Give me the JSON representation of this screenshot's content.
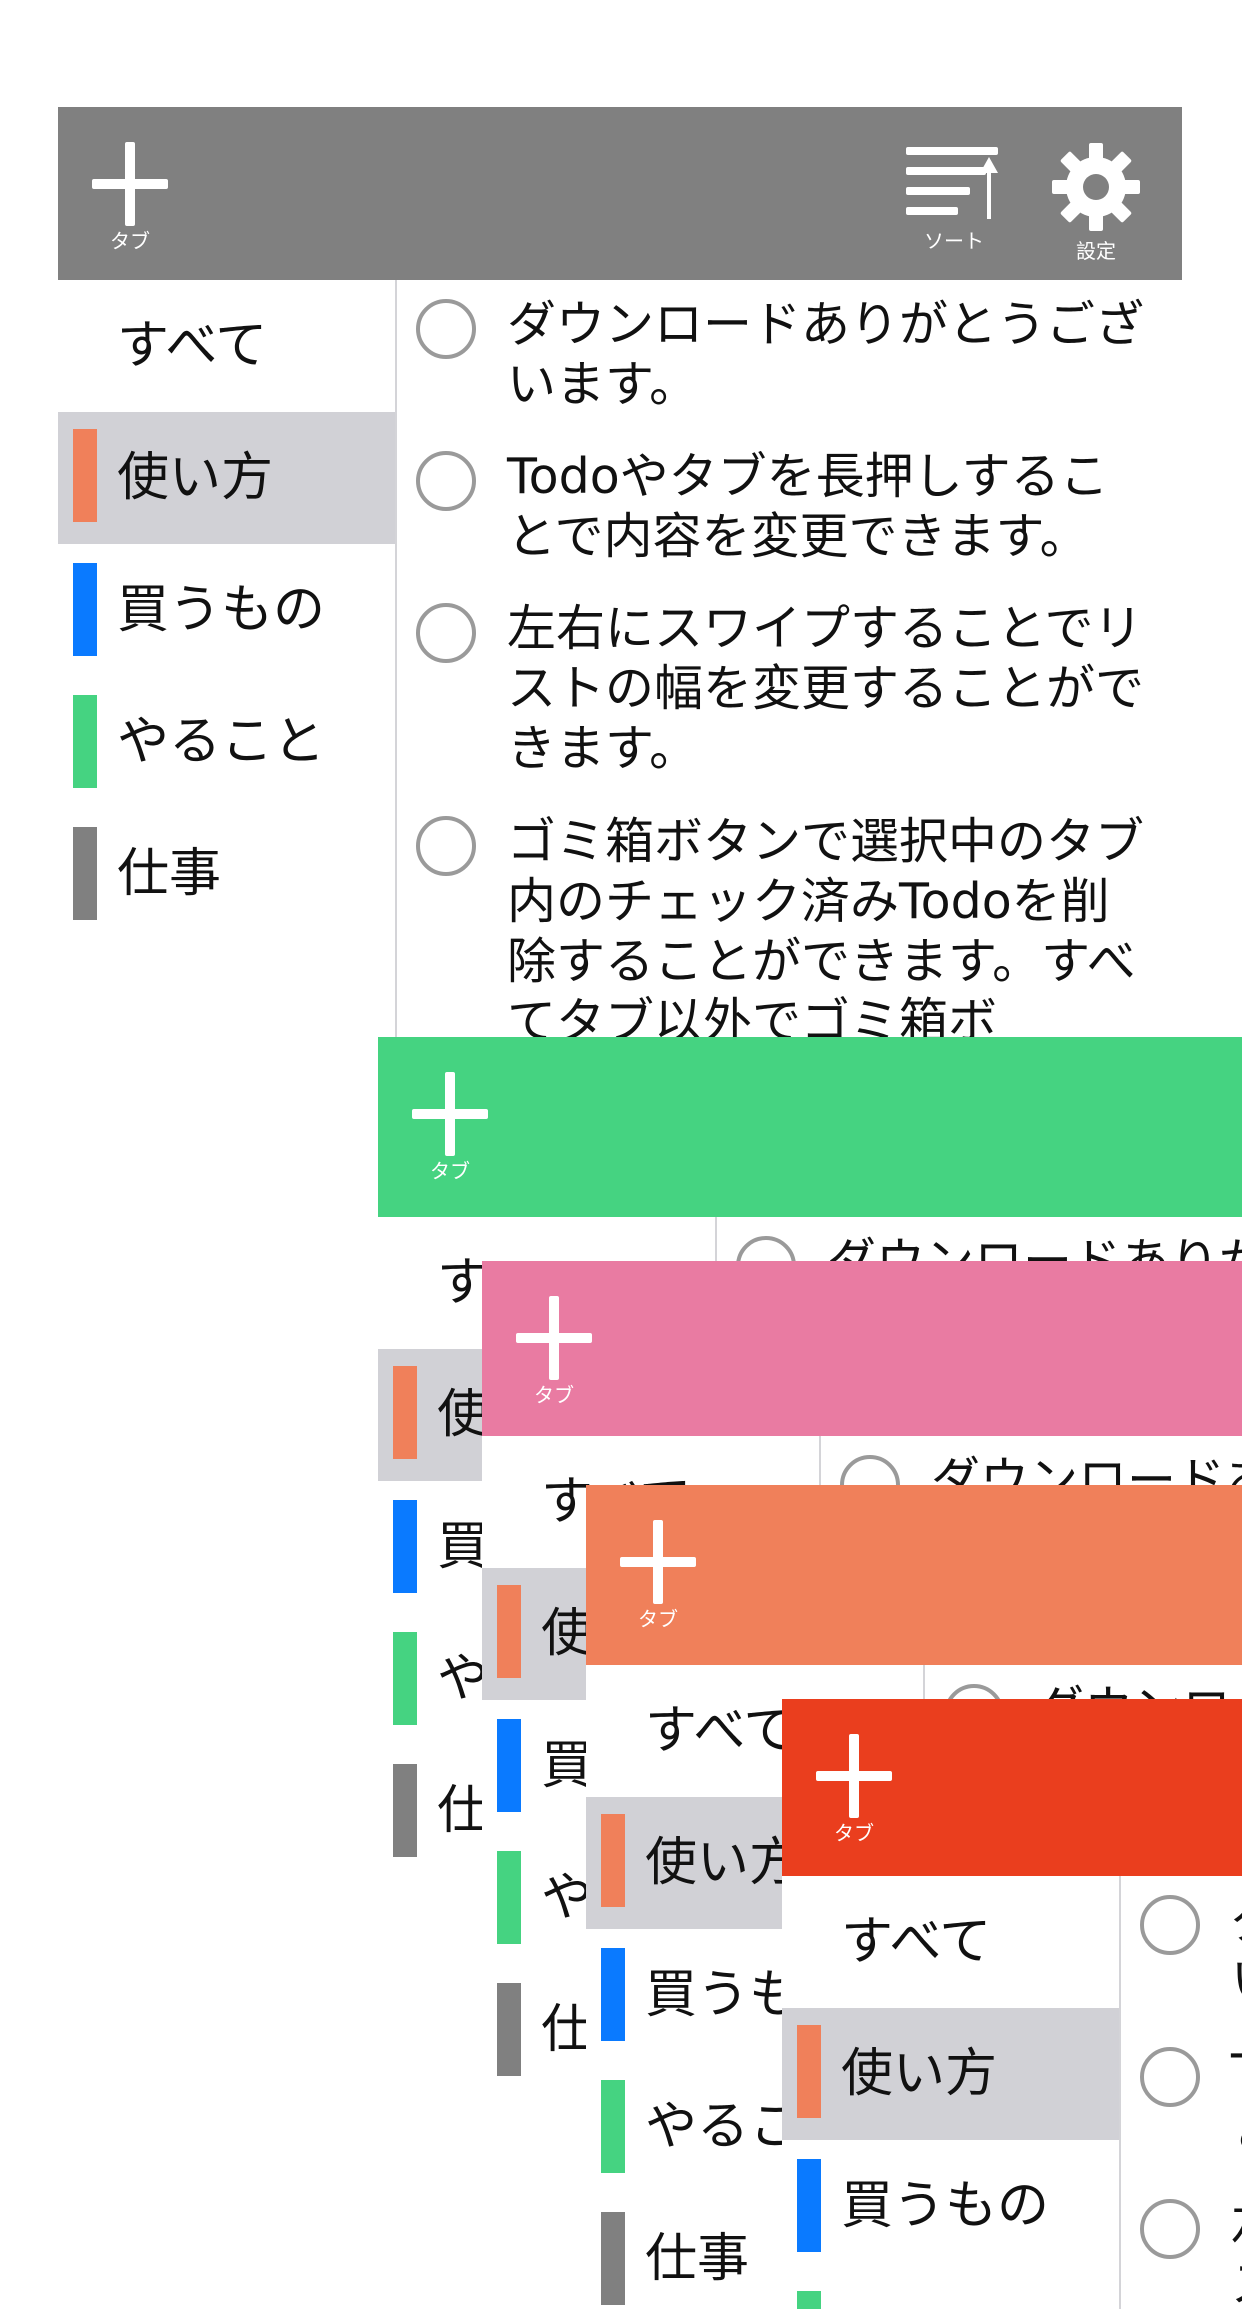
{
  "header": {
    "add_tab_caption": "タブ",
    "sort_caption": "ソート",
    "settings_caption": "設定"
  },
  "sidebar": {
    "items": [
      {
        "label": "すべて",
        "color": null,
        "selected": false
      },
      {
        "label": "使い方",
        "color": "#f0805a",
        "selected": true
      },
      {
        "label": "買うもの",
        "color": "#0a7aff",
        "selected": false
      },
      {
        "label": "やること",
        "color": "#45d381",
        "selected": false
      },
      {
        "label": "仕事",
        "color": "#808080",
        "selected": false
      }
    ]
  },
  "todos": [
    {
      "text": "ダウンロードありがとうございます。"
    },
    {
      "text": "Todoやタブを長押しすることで内容を変更できます。"
    },
    {
      "text": "左右にスワイプすることでリストの幅を変更することができます。"
    },
    {
      "text": "ゴミ箱ボタンで選択中のタブ内のチェック済みTodoを削除することができます。すべてタブ以外でゴミ箱ボ"
    }
  ],
  "theme_colors": {
    "gray": "#808080",
    "green": "#45d381",
    "pink": "#e97ba2",
    "orange": "#f0805a",
    "red": "#ea3e1e"
  }
}
